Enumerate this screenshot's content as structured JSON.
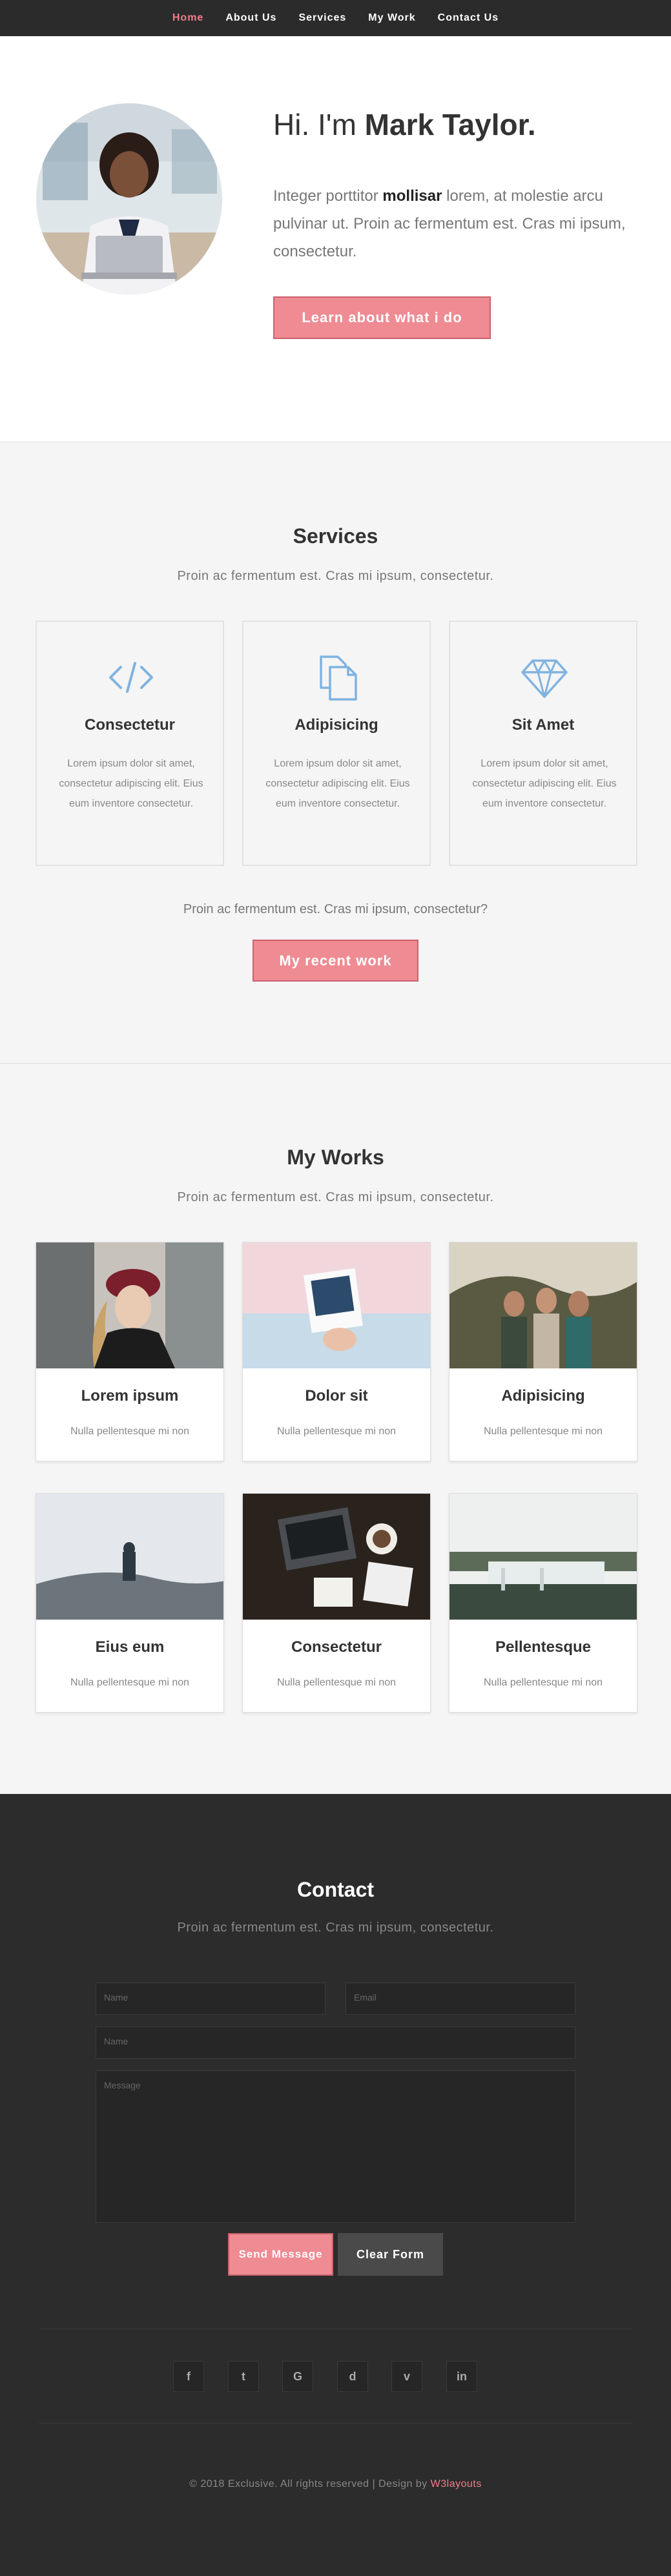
{
  "nav": {
    "items": [
      "Home",
      "About Us",
      "Services",
      "My Work",
      "Contact Us"
    ],
    "active": "Home"
  },
  "hero": {
    "title_pre": "Hi. I'm ",
    "title_name": "Mark Taylor.",
    "text_pre": "Integer porttitor ",
    "text_bold": "mollisar",
    "text_post": " lorem, at molestie arcu pulvinar ut. Proin ac fermentum est. Cras mi ipsum, consectetur.",
    "button": "Learn about what i do"
  },
  "services": {
    "title": "Services",
    "subtitle": "Proin ac fermentum est. Cras mi ipsum, consectetur.",
    "cards": [
      {
        "icon": "code-icon",
        "title": "Consectetur",
        "text": "Lorem ipsum dolor sit amet, consectetur adipiscing elit. Eius eum inventore consectetur."
      },
      {
        "icon": "copy-icon",
        "title": "Adipisicing",
        "text": "Lorem ipsum dolor sit amet, consectetur adipiscing elit. Eius eum inventore consectetur."
      },
      {
        "icon": "diamond-icon",
        "title": "Sit Amet",
        "text": "Lorem ipsum dolor sit amet, consectetur adipiscing elit. Eius eum inventore consectetur."
      }
    ],
    "bottom_text": "Proin ac fermentum est. Cras mi ipsum, consectetur?",
    "button": "My recent work"
  },
  "works": {
    "title": "My Works",
    "subtitle": "Proin ac fermentum est. Cras mi ipsum, consectetur.",
    "items": [
      {
        "title": "Lorem ipsum",
        "sub": "Nulla pellentesque mi non"
      },
      {
        "title": "Dolor sit",
        "sub": "Nulla pellentesque mi non"
      },
      {
        "title": "Adipisicing",
        "sub": "Nulla pellentesque mi non"
      },
      {
        "title": "Eius eum",
        "sub": "Nulla pellentesque mi non"
      },
      {
        "title": "Consectetur",
        "sub": "Nulla pellentesque mi non"
      },
      {
        "title": "Pellentesque",
        "sub": "Nulla pellentesque mi non"
      }
    ]
  },
  "contact": {
    "title": "Contact",
    "subtitle": "Proin ac fermentum est. Cras mi ipsum, consectetur.",
    "name_placeholder": "Name",
    "email_placeholder": "Email",
    "subject_placeholder": "Name",
    "message_placeholder": "Message",
    "send_button": "Send Message",
    "clear_button": "Clear Form",
    "social": [
      "f",
      "t",
      "G",
      "d",
      "v",
      "in"
    ],
    "social_icons": [
      "facebook-icon",
      "twitter-icon",
      "google-icon",
      "dribbble-icon",
      "vimeo-icon",
      "linkedin-icon"
    ]
  },
  "footer": {
    "text": "© 2018 Exclusive. All rights reserved | Design by ",
    "link": "W3layouts"
  },
  "colors": {
    "accent": "#ef8b93",
    "nav_bg": "#2b2b2b",
    "section_bg": "#f5f5f5",
    "contact_bg": "#2c2c2c",
    "icon_blue": "#7fb3e0"
  }
}
